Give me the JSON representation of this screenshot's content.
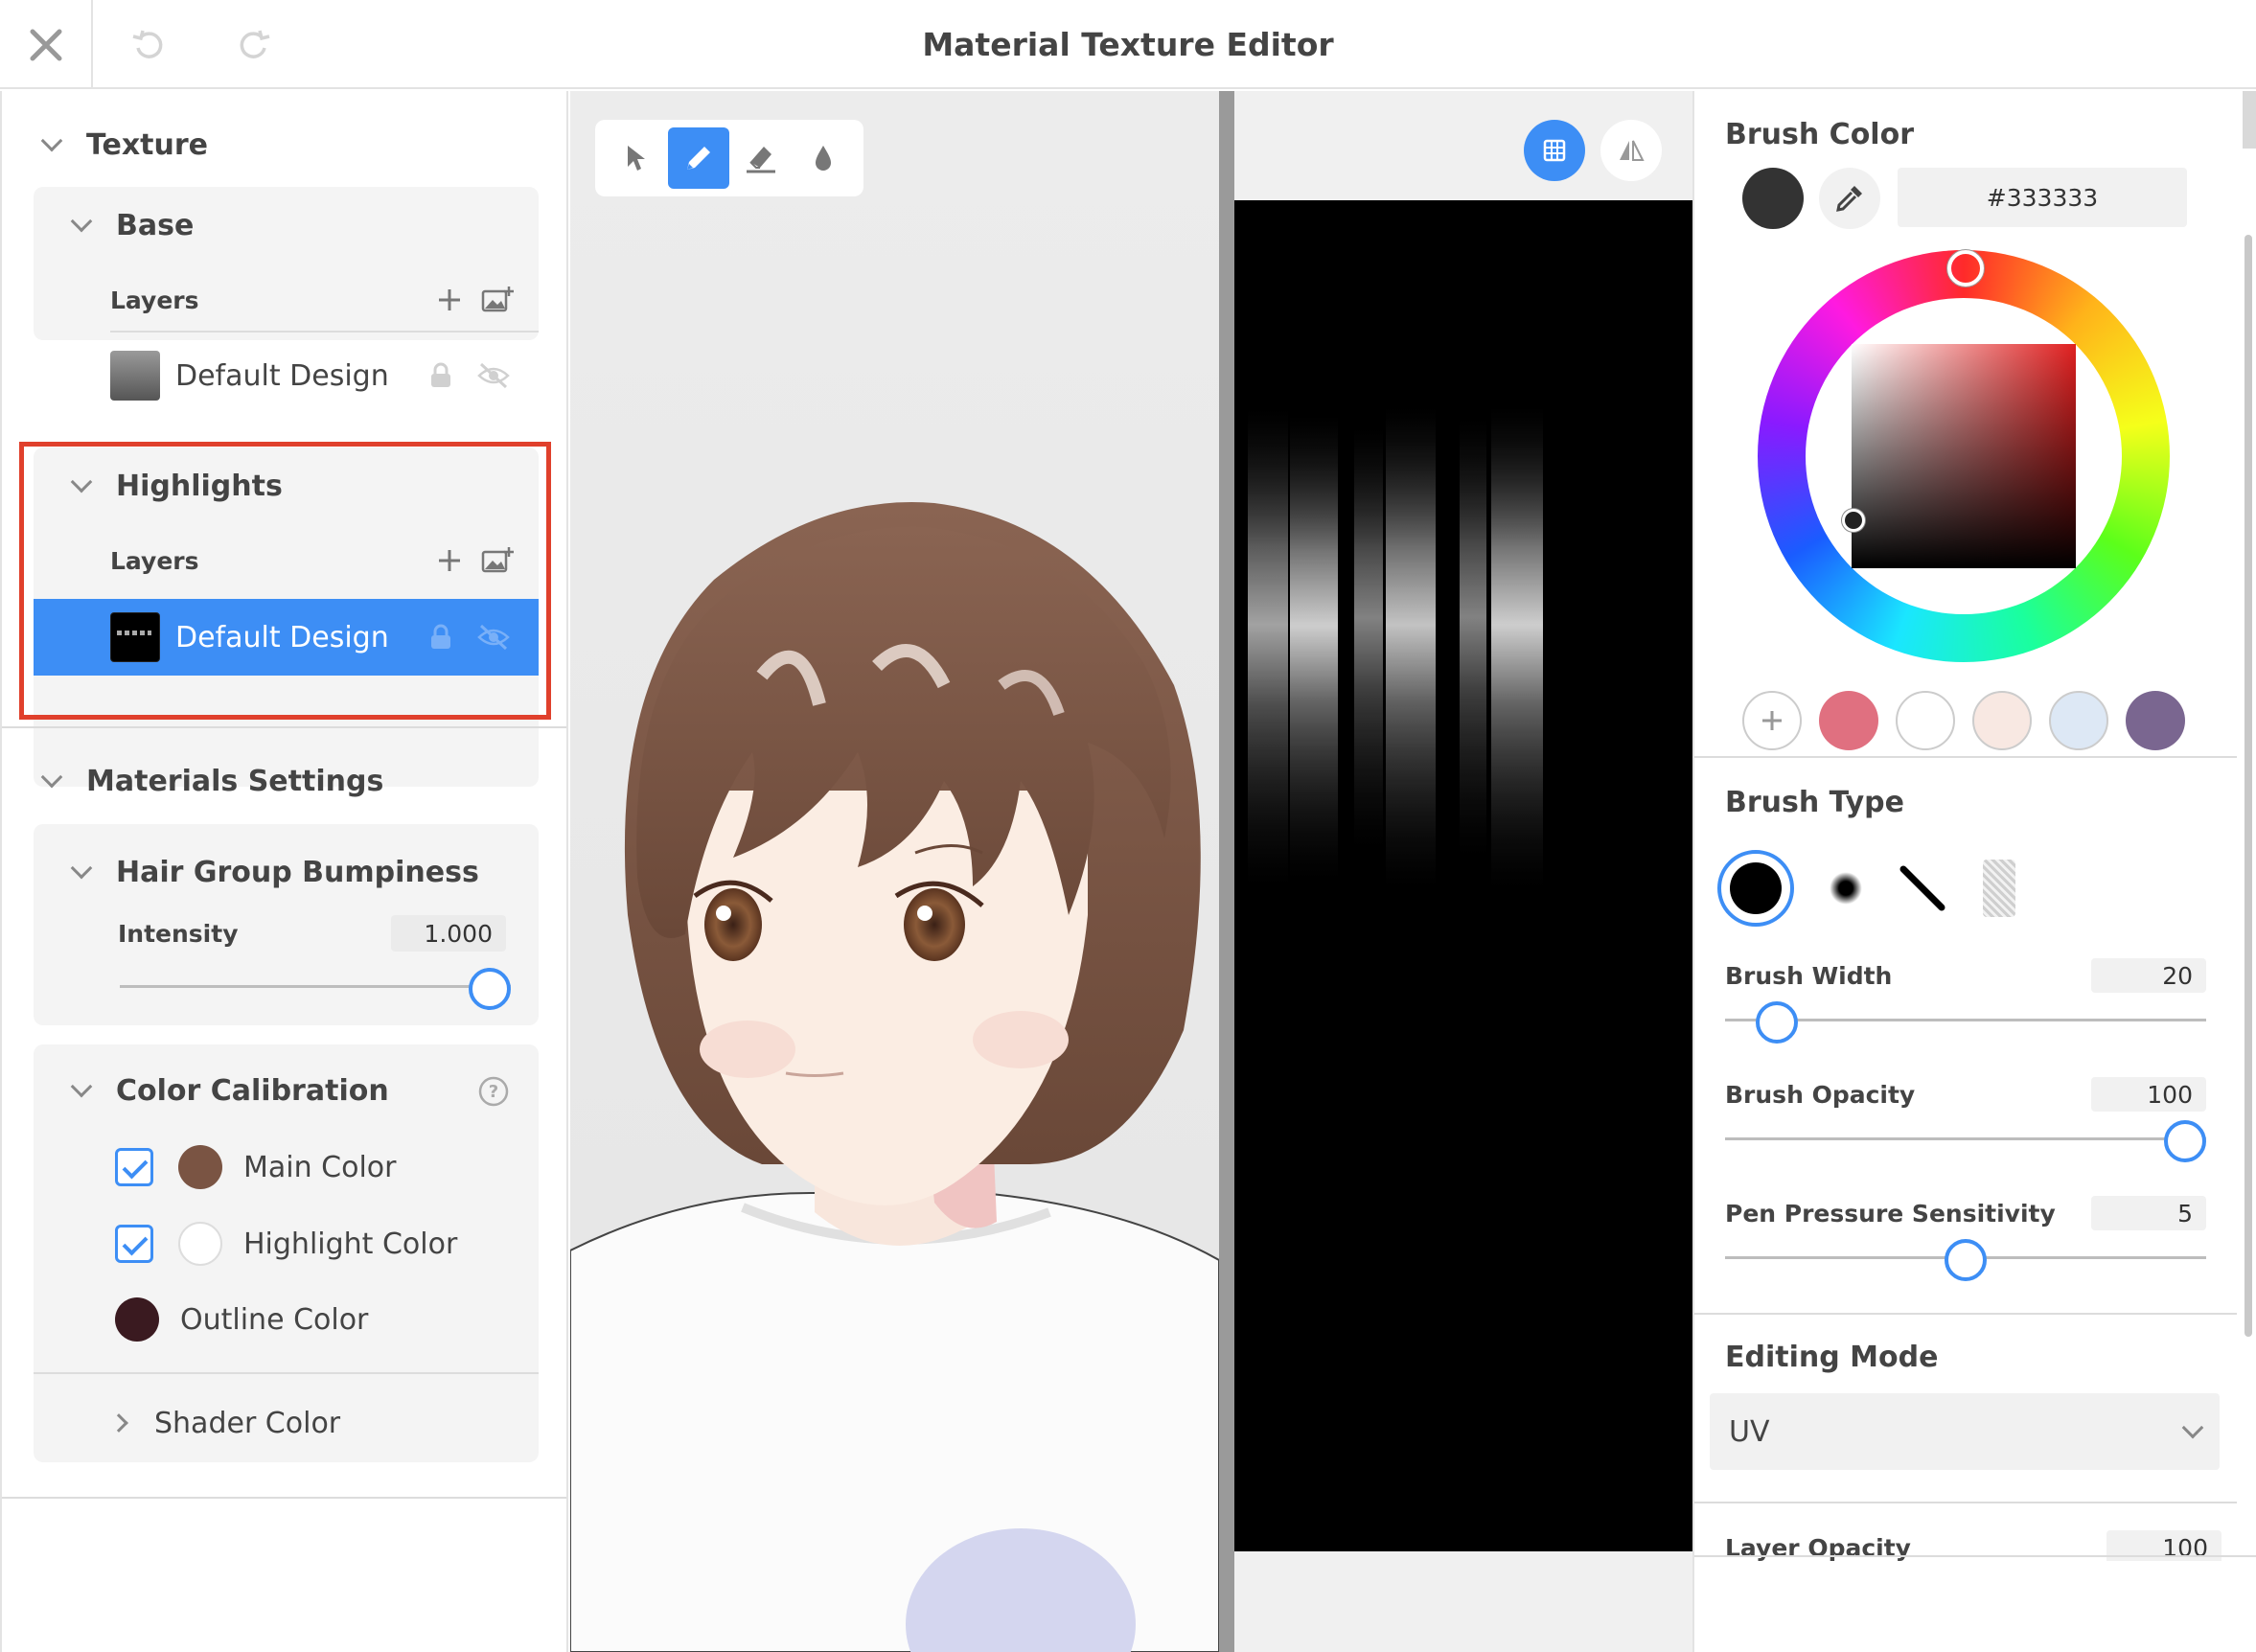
{
  "window": {
    "title": "Material Texture Editor"
  },
  "left": {
    "texture_label": "Texture",
    "base": {
      "title": "Base",
      "layers_label": "Layers",
      "layer_name": "Default Design"
    },
    "highlights": {
      "title": "Highlights",
      "layers_label": "Layers",
      "layer_name": "Default Design"
    },
    "materials_label": "Materials Settings",
    "bumpiness": {
      "title": "Hair Group Bumpiness",
      "intensity_label": "Intensity",
      "intensity_value": "1.000",
      "intensity_fraction": 1.0
    },
    "calibration": {
      "title": "Color Calibration",
      "items": [
        {
          "label": "Main Color",
          "checked": true,
          "color": "#7a5443"
        },
        {
          "label": "Highlight Color",
          "checked": true,
          "color": "#ffffff"
        },
        {
          "label": "Outline Color",
          "checked": false,
          "color": "#3a1a20"
        }
      ],
      "shader_label": "Shader Color"
    }
  },
  "right": {
    "brush_color_label": "Brush Color",
    "current_color": "#333333",
    "hex_value": "#333333",
    "presets": [
      "#e07080",
      "#ffffff",
      "#f8e8e2",
      "#dde8f5",
      "#7a6690"
    ],
    "brush_type_label": "Brush Type",
    "brush_width": {
      "label": "Brush Width",
      "value": "20",
      "fraction": 0.07
    },
    "brush_opacity": {
      "label": "Brush Opacity",
      "value": "100",
      "fraction": 1.0
    },
    "pen_pressure": {
      "label": "Pen Pressure Sensitivity",
      "value": "5",
      "fraction": 0.5
    },
    "editing_mode_label": "Editing Mode",
    "editing_mode_value": "UV",
    "layer_opacity": {
      "label": "Layer Opacity",
      "value": "100"
    }
  },
  "colors": {
    "accent": "#3d8ef5",
    "selection_outline": "#e0402c"
  }
}
